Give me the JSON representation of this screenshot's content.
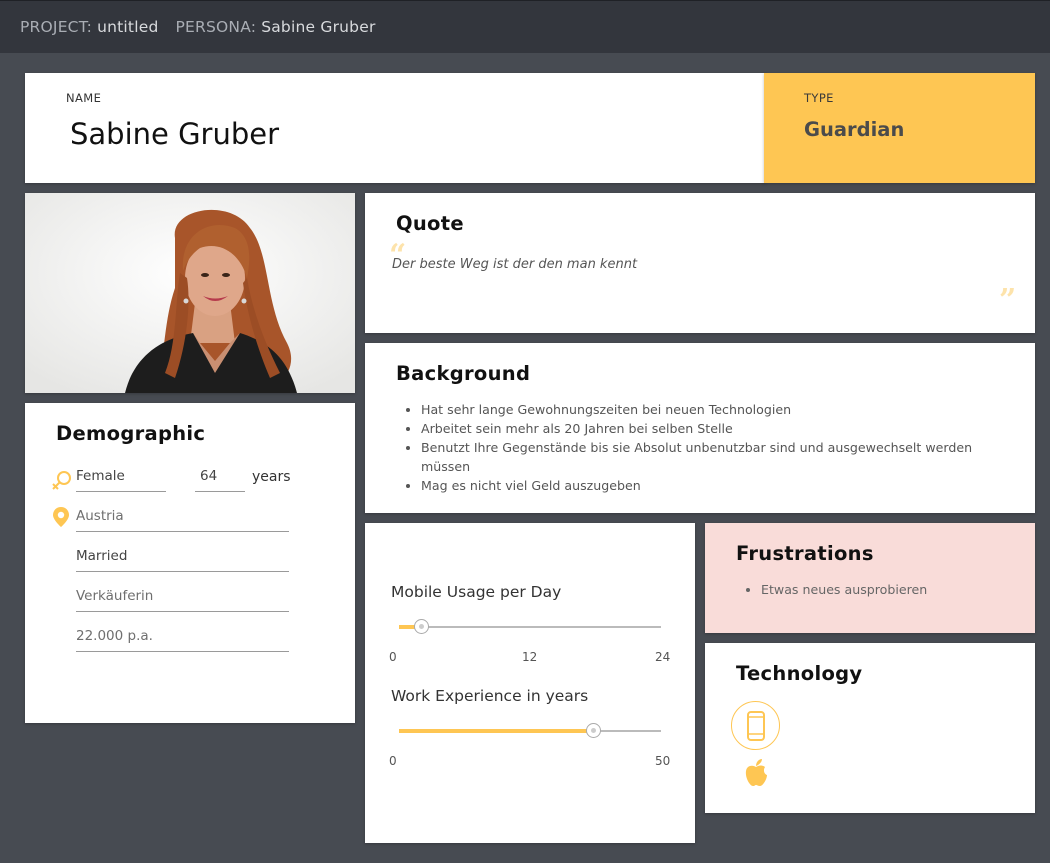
{
  "topbar": {
    "project_label": "PROJECT:",
    "project_value": "untitled",
    "persona_label": "PERSONA:",
    "persona_value": "Sabine Gruber"
  },
  "name_card": {
    "label": "NAME",
    "value": "Sabine Gruber"
  },
  "type_card": {
    "label": "TYPE",
    "value": "Guardian"
  },
  "demographic": {
    "title": "Demographic",
    "gender": "Female",
    "age": "64",
    "age_unit": "years",
    "location": "Austria",
    "marital_status": "Married",
    "occupation": "Verkäuferin",
    "income": "22.000 p.a.",
    "icons": [
      "gender-icon",
      "location-pin-icon"
    ]
  },
  "quote": {
    "title": "Quote",
    "text": "Der beste Weg ist der den man kennt",
    "open_mark": "“",
    "close_mark": "”"
  },
  "background": {
    "title": "Background",
    "items": [
      "Hat sehr lange Gewohnungszeiten bei neuen Technologien",
      "Arbeitet sein mehr als 20 Jahren bei selben Stelle",
      "Benutzt Ihre Gegenstände bis sie Absolut unbenutzbar sind und ausgewechselt werden müssen",
      "Mag es nicht viel Geld auszugeben"
    ]
  },
  "sliders": {
    "mobile_usage": {
      "title": "Mobile Usage per Day",
      "min": "0",
      "mid": "12",
      "max": "24",
      "value": 2
    },
    "work_experience": {
      "title": "Work Experience in years",
      "min": "0",
      "max": "50",
      "value": 37
    }
  },
  "frustrations": {
    "title": "Frustrations",
    "items": [
      "Etwas neues ausprobieren"
    ]
  },
  "technology": {
    "title": "Technology",
    "icons": [
      "smartphone-icon",
      "apple-icon"
    ],
    "accent": "#fec653"
  },
  "colors": {
    "accent": "#fec653",
    "topbar": "#33363d",
    "background": "#474b52",
    "frustrations_bg": "#f9dcd9"
  }
}
